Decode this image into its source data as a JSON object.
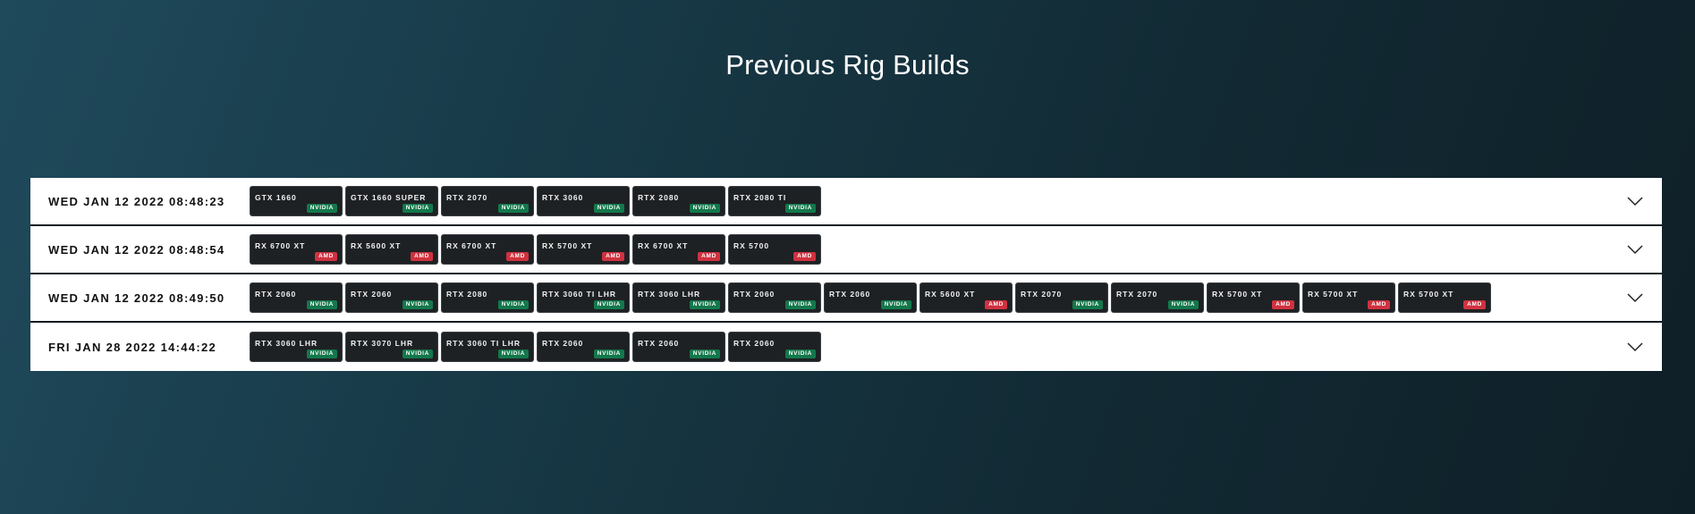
{
  "page": {
    "title": "Previous Rig Builds"
  },
  "vendors": {
    "NVIDIA": {
      "label": "NVIDIA",
      "color": "#13784b"
    },
    "AMD": {
      "label": "AMD",
      "color": "#d0313f"
    }
  },
  "builds": [
    {
      "date": "WED JAN 12 2022 08:48:23",
      "gpus": [
        {
          "name": "GTX 1660",
          "vendor": "NVIDIA"
        },
        {
          "name": "GTX 1660 SUPER",
          "vendor": "NVIDIA"
        },
        {
          "name": "RTX 2070",
          "vendor": "NVIDIA"
        },
        {
          "name": "RTX 3060",
          "vendor": "NVIDIA"
        },
        {
          "name": "RTX 2080",
          "vendor": "NVIDIA"
        },
        {
          "name": "RTX 2080 TI",
          "vendor": "NVIDIA"
        }
      ]
    },
    {
      "date": "WED JAN 12 2022 08:48:54",
      "gpus": [
        {
          "name": "RX 6700 XT",
          "vendor": "AMD"
        },
        {
          "name": "RX 5600 XT",
          "vendor": "AMD"
        },
        {
          "name": "RX 6700 XT",
          "vendor": "AMD"
        },
        {
          "name": "RX 5700 XT",
          "vendor": "AMD"
        },
        {
          "name": "RX 6700 XT",
          "vendor": "AMD"
        },
        {
          "name": "RX 5700",
          "vendor": "AMD"
        }
      ]
    },
    {
      "date": "WED JAN 12 2022 08:49:50",
      "gpus": [
        {
          "name": "RTX 2060",
          "vendor": "NVIDIA"
        },
        {
          "name": "RTX 2060",
          "vendor": "NVIDIA"
        },
        {
          "name": "RTX 2080",
          "vendor": "NVIDIA"
        },
        {
          "name": "RTX 3060 TI LHR",
          "vendor": "NVIDIA"
        },
        {
          "name": "RTX 3060 LHR",
          "vendor": "NVIDIA"
        },
        {
          "name": "RTX 2060",
          "vendor": "NVIDIA"
        },
        {
          "name": "RTX 2060",
          "vendor": "NVIDIA"
        },
        {
          "name": "RX 5600 XT",
          "vendor": "AMD"
        },
        {
          "name": "RTX 2070",
          "vendor": "NVIDIA"
        },
        {
          "name": "RTX 2070",
          "vendor": "NVIDIA"
        },
        {
          "name": "RX 5700 XT",
          "vendor": "AMD"
        },
        {
          "name": "RX 5700 XT",
          "vendor": "AMD"
        },
        {
          "name": "RX 5700 XT",
          "vendor": "AMD"
        }
      ]
    },
    {
      "date": "FRI JAN 28 2022 14:44:22",
      "gpus": [
        {
          "name": "RTX 3060 LHR",
          "vendor": "NVIDIA"
        },
        {
          "name": "RTX 3070 LHR",
          "vendor": "NVIDIA"
        },
        {
          "name": "RTX 3060 TI LHR",
          "vendor": "NVIDIA"
        },
        {
          "name": "RTX 2060",
          "vendor": "NVIDIA"
        },
        {
          "name": "RTX 2060",
          "vendor": "NVIDIA"
        },
        {
          "name": "RTX 2060",
          "vendor": "NVIDIA"
        }
      ]
    }
  ]
}
